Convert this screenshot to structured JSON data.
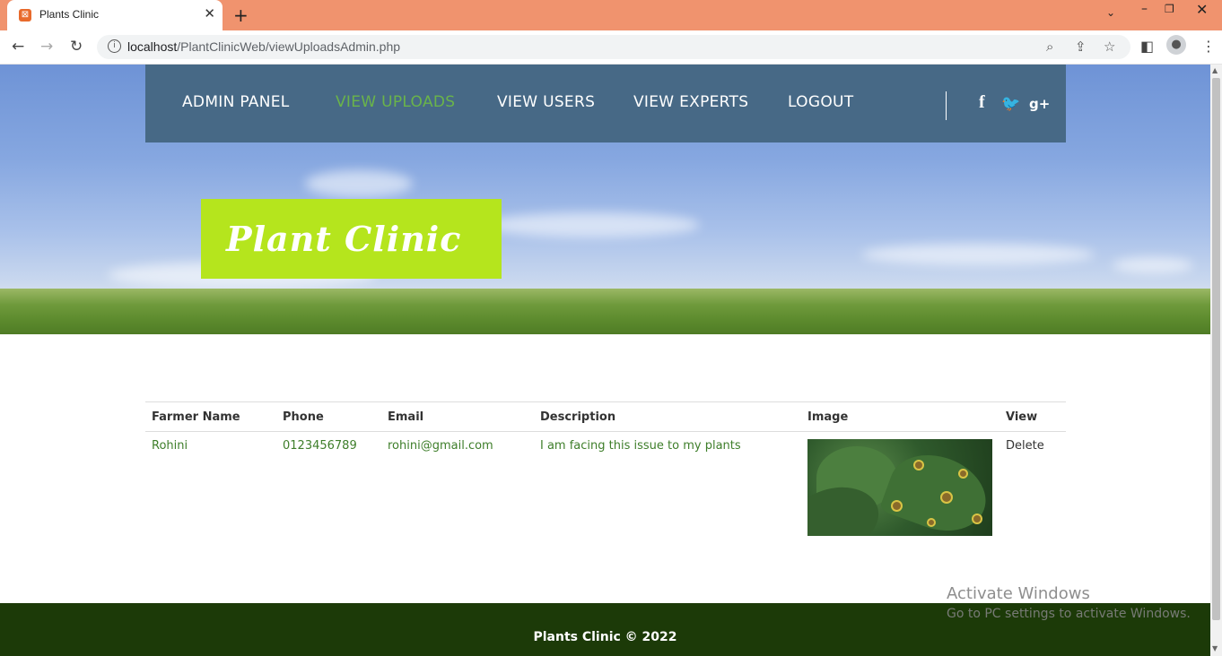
{
  "browser": {
    "tab_title": "Plants Clinic",
    "url_host": "localhost",
    "url_path": "/PlantClinicWeb/viewUploadsAdmin.php"
  },
  "nav": {
    "items": [
      "ADMIN PANEL",
      "VIEW UPLOADS",
      "VIEW USERS",
      "VIEW EXPERTS",
      "LOGOUT"
    ],
    "active": "VIEW UPLOADS",
    "social": [
      "facebook-icon",
      "twitter-icon",
      "google-plus-icon"
    ]
  },
  "logo": {
    "text": "Plant Clinic",
    "bg": "#b5e51d"
  },
  "table": {
    "headers": [
      "Farmer Name",
      "Phone",
      "Email",
      "Description",
      "Image",
      "View"
    ],
    "rows": [
      {
        "farmer_name": "Rohini",
        "phone": "0123456789",
        "email": "rohini@gmail.com",
        "description": "I am facing this issue to my plants",
        "image": "diseased-leaf-photo",
        "action": "Delete"
      }
    ]
  },
  "footer": {
    "text": "Plants Clinic © 2022"
  },
  "watermark": {
    "title": "Activate Windows",
    "subtitle": "Go to PC settings to activate Windows."
  },
  "colors": {
    "navbar": "#476986",
    "active_link": "#6ab44a",
    "footer": "#1c3a08",
    "cell_text": "#3e7e2a",
    "tabbar": "#f0936e"
  }
}
